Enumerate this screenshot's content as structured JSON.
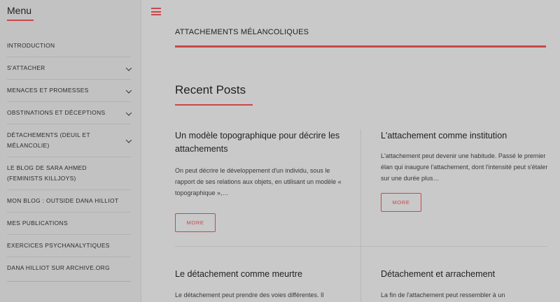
{
  "sidebar": {
    "title": "Menu",
    "items": [
      {
        "label": "INTRODUCTION",
        "has_submenu": false
      },
      {
        "label": "S'ATTACHER",
        "has_submenu": true
      },
      {
        "label": "MENACES ET PROMESSES",
        "has_submenu": true
      },
      {
        "label": "OBSTINATIONS ET DÉCEPTIONS",
        "has_submenu": true
      },
      {
        "label": "DÉTACHEMENTS (DEUIL ET MÉLANCOLIE)",
        "has_submenu": true
      },
      {
        "label": "LE BLOG DE SARA AHMED (FEMINISTS KILLJOYS)",
        "has_submenu": false
      },
      {
        "label": "MON BLOG : OUTSIDE DANA HILLIOT",
        "has_submenu": false
      },
      {
        "label": "MES PUBLICATIONS",
        "has_submenu": false
      },
      {
        "label": "EXERCICES PSYCHANALYTIQUES",
        "has_submenu": false
      },
      {
        "label": "DANA HILLIOT SUR ARCHIVE.ORG",
        "has_submenu": false
      }
    ]
  },
  "header": {
    "menu_icon": "hamburger-icon",
    "site_title": "ATTACHEMENTS MÉLANCOLIQUES"
  },
  "main": {
    "section_title": "Recent Posts",
    "posts": [
      {
        "title": "Un modèle topographique pour décrire les attachements",
        "excerpt": "On peut décrire le développement d'un individu, sous le rapport de ses relations aux objets, en utilisant un modèle « topographique »,…",
        "button": "MORE"
      },
      {
        "title": "L'attachement comme institution",
        "excerpt": "L'attachement peut devenir une habitude. Passé le premier élan qui inaugure l'attachement, dont l'intensité peut s'étaler sur une durée plus…",
        "button": "MORE"
      },
      {
        "title": "Le détachement comme meurtre",
        "excerpt": "Le détachement peut prendre des voies différentes. Il",
        "button": ""
      },
      {
        "title": "Détachement et arrachement",
        "excerpt": "La fin de l'attachement peut ressembler à un",
        "button": ""
      }
    ]
  },
  "colors": {
    "accent": "#c9474a",
    "background": "#c9c9c9",
    "sidebar": "#c2c2c2"
  }
}
